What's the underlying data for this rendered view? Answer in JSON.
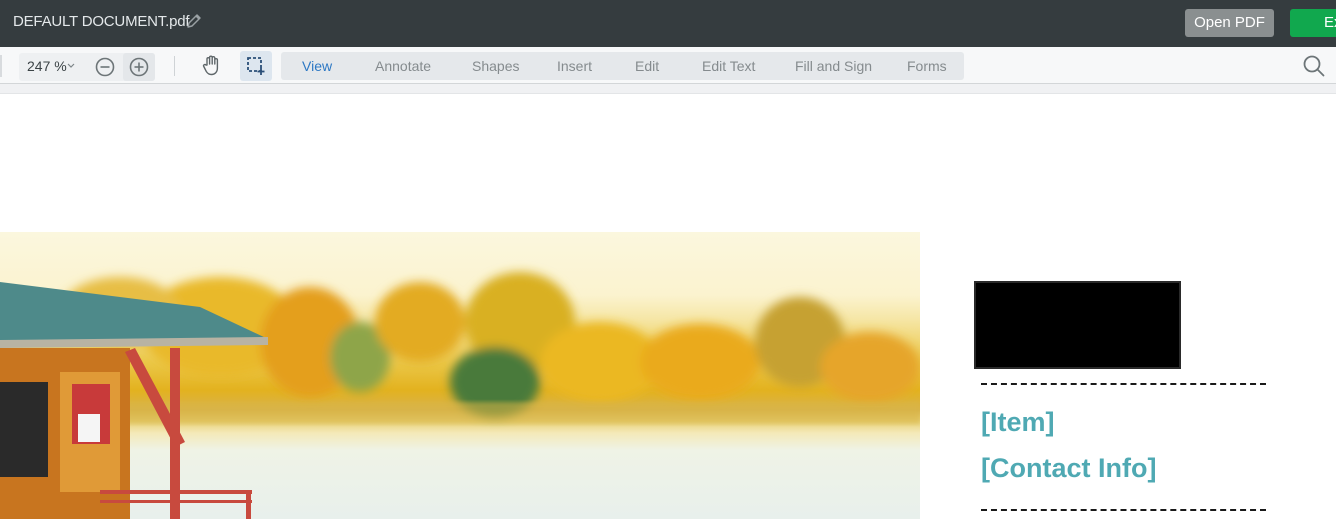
{
  "titlebar": {
    "document_title": "DEFAULT DOCUMENT.pdf",
    "edit_icon": "pencil-icon",
    "open_pdf_label": "Open PDF",
    "export_label": "Ex"
  },
  "toolbar": {
    "zoom_value": "247 %",
    "zoom_out_icon": "minus-circle-icon",
    "zoom_in_icon": "plus-circle-icon",
    "hand_tool_icon": "hand-icon",
    "select_tool_icon": "area-select-icon",
    "search_icon": "search-icon",
    "modes": [
      {
        "label": "View",
        "active": true
      },
      {
        "label": "Annotate",
        "active": false
      },
      {
        "label": "Shapes",
        "active": false
      },
      {
        "label": "Insert",
        "active": false
      },
      {
        "label": "Edit",
        "active": false
      },
      {
        "label": "Edit Text",
        "active": false
      },
      {
        "label": "Fill and Sign",
        "active": false
      },
      {
        "label": "Forms",
        "active": false
      }
    ]
  },
  "document": {
    "image_description": "Lakeside boathouse with autumn trees",
    "item_text": "[Item]",
    "contact_text": "[Contact Info]"
  },
  "colors": {
    "titlebar_bg": "#353c3f",
    "export_green": "#11a84e",
    "active_tab": "#2d78c4",
    "accent_teal": "#4fa9b3"
  }
}
